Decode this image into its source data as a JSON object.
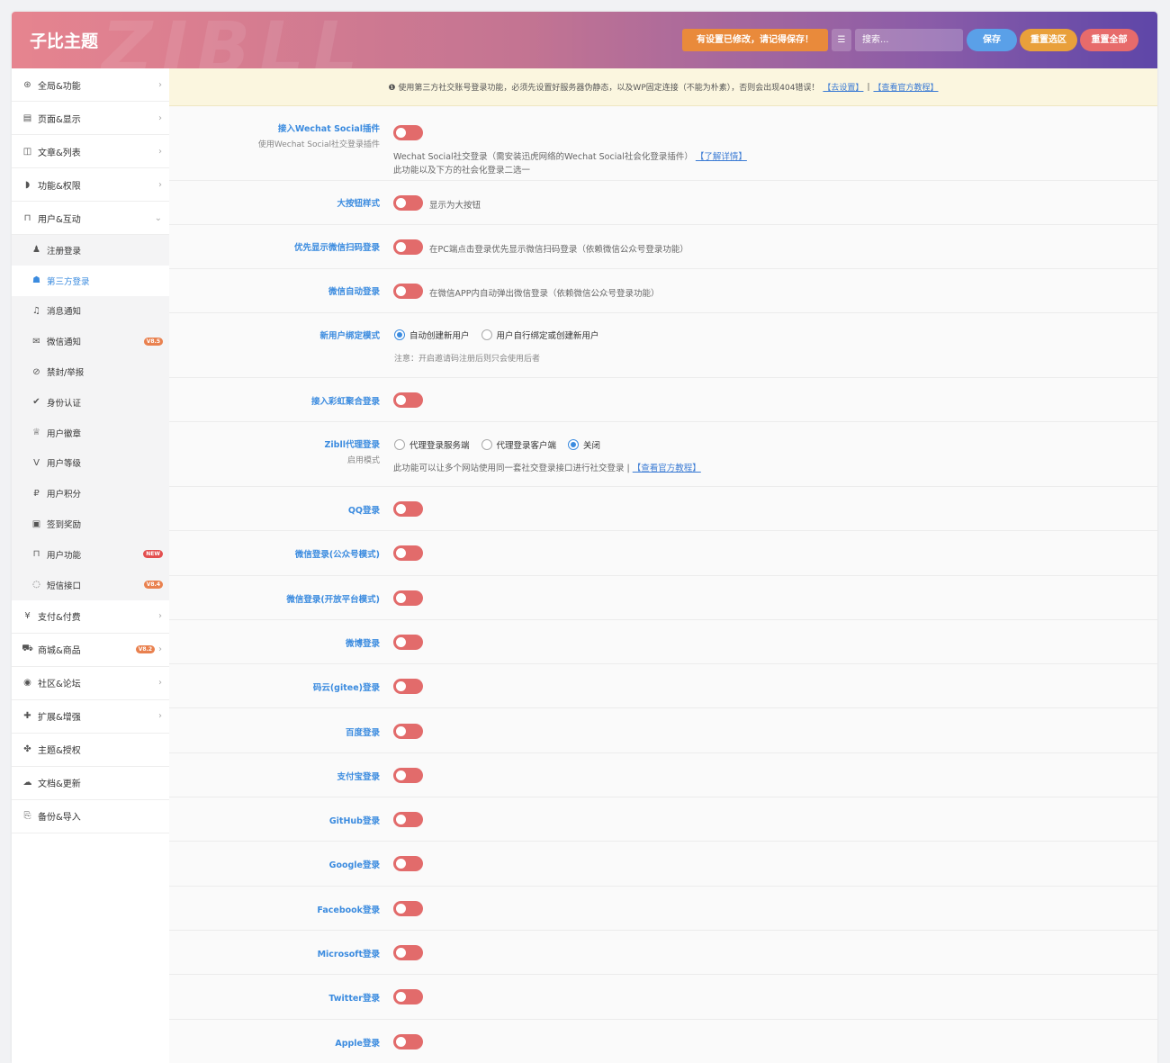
{
  "header": {
    "brand": "子比主题",
    "watermark": "ZIBLL",
    "unsaved_notice": "有设置已修改，请记得保存！",
    "search_placeholder": "搜索...",
    "save_label": "保存",
    "reset_section_label": "重置选区",
    "reset_all_label": "重置全部"
  },
  "sidebar": {
    "items_top": [
      {
        "label": "全局&功能",
        "icon": "⊛"
      },
      {
        "label": "页面&显示",
        "icon": "▤"
      },
      {
        "label": "文章&列表",
        "icon": "◫"
      },
      {
        "label": "功能&权限",
        "icon": "◗"
      },
      {
        "label": "用户&互动",
        "icon": "⊓"
      }
    ],
    "sub_items": [
      {
        "label": "注册登录",
        "icon": "♟"
      },
      {
        "label": "第三方登录",
        "icon": "☗"
      },
      {
        "label": "消息通知",
        "icon": "♫"
      },
      {
        "label": "微信通知",
        "icon": "✉",
        "badge": "V8.5"
      },
      {
        "label": "禁封/举报",
        "icon": "⊘"
      },
      {
        "label": "身份认证",
        "icon": "✔"
      },
      {
        "label": "用户徽章",
        "icon": "♕"
      },
      {
        "label": "用户等级",
        "icon": "V"
      },
      {
        "label": "用户积分",
        "icon": "₽"
      },
      {
        "label": "签到奖励",
        "icon": "▣"
      },
      {
        "label": "用户功能",
        "icon": "⊓",
        "badge": "NEW"
      },
      {
        "label": "短信接口",
        "icon": "◌",
        "badge": "V8.4"
      }
    ],
    "items_bottom": [
      {
        "label": "支付&付费",
        "icon": "¥"
      },
      {
        "label": "商城&商品",
        "icon": "⛟",
        "badge": "V8.2"
      },
      {
        "label": "社区&论坛",
        "icon": "◉"
      },
      {
        "label": "扩展&增强",
        "icon": "✚"
      },
      {
        "label": "主题&授权",
        "icon": "✤"
      },
      {
        "label": "文档&更新",
        "icon": "☁"
      },
      {
        "label": "备份&导入",
        "icon": "⎘"
      }
    ]
  },
  "notice": {
    "text": "❶ 使用第三方社交账号登录功能，必须先设置好服务器伪静态，以及WP固定连接（不能为朴素），否则会出现404错误！",
    "link1": "【去设置】",
    "sep": "|",
    "link2": "【查看官方教程】"
  },
  "settings": {
    "wechat_social": {
      "title": "接入Wechat Social插件",
      "subtitle": "使用Wechat Social社交登录插件",
      "desc": "Wechat Social社交登录（需安装迅虎网络的Wechat Social社会化登录插件）",
      "link": "【了解详情】",
      "desc2": "此功能以及下方的社会化登录二选一"
    },
    "big_button": {
      "title": "大按钮样式",
      "desc": "显示为大按钮"
    },
    "wechat_qr_first": {
      "title": "优先显示微信扫码登录",
      "desc": "在PC端点击登录优先显示微信扫码登录（依赖微信公众号登录功能）"
    },
    "wechat_auto": {
      "title": "微信自动登录",
      "desc": "在微信APP内自动弹出微信登录（依赖微信公众号登录功能）"
    },
    "bind_mode": {
      "title": "新用户绑定模式",
      "options": [
        "自动创建新用户",
        "用户自行绑定或创建新用户"
      ],
      "selected": "自动创建新用户",
      "note": "注意：开启邀请码注册后则只会使用后者"
    },
    "rainbow": {
      "title": "接入彩虹聚合登录"
    },
    "zibll_proxy": {
      "title": "Zibll代理登录",
      "subtitle": "启用模式",
      "options": [
        "代理登录服务端",
        "代理登录客户端",
        "关闭"
      ],
      "selected": "关闭",
      "desc": "此功能可以让多个网站使用同一套社交登录接口进行社交登录 |",
      "link": "【查看官方教程】"
    },
    "providers": [
      "QQ登录",
      "微信登录(公众号模式)",
      "微信登录(开放平台模式)",
      "微博登录",
      "码云(gitee)登录",
      "百度登录",
      "支付宝登录",
      "GitHub登录",
      "Google登录",
      "Facebook登录",
      "Microsoft登录",
      "Twitter登录",
      "Apple登录"
    ]
  },
  "colors": {
    "accent": "#3b8bdf",
    "toggle_off": "#e26b6b",
    "notice_bg": "#fbf6df",
    "unsaved": "#e98a3b",
    "save": "#5aa0e8",
    "reset_section": "#e9a03b",
    "reset_all": "#e76b6b"
  }
}
